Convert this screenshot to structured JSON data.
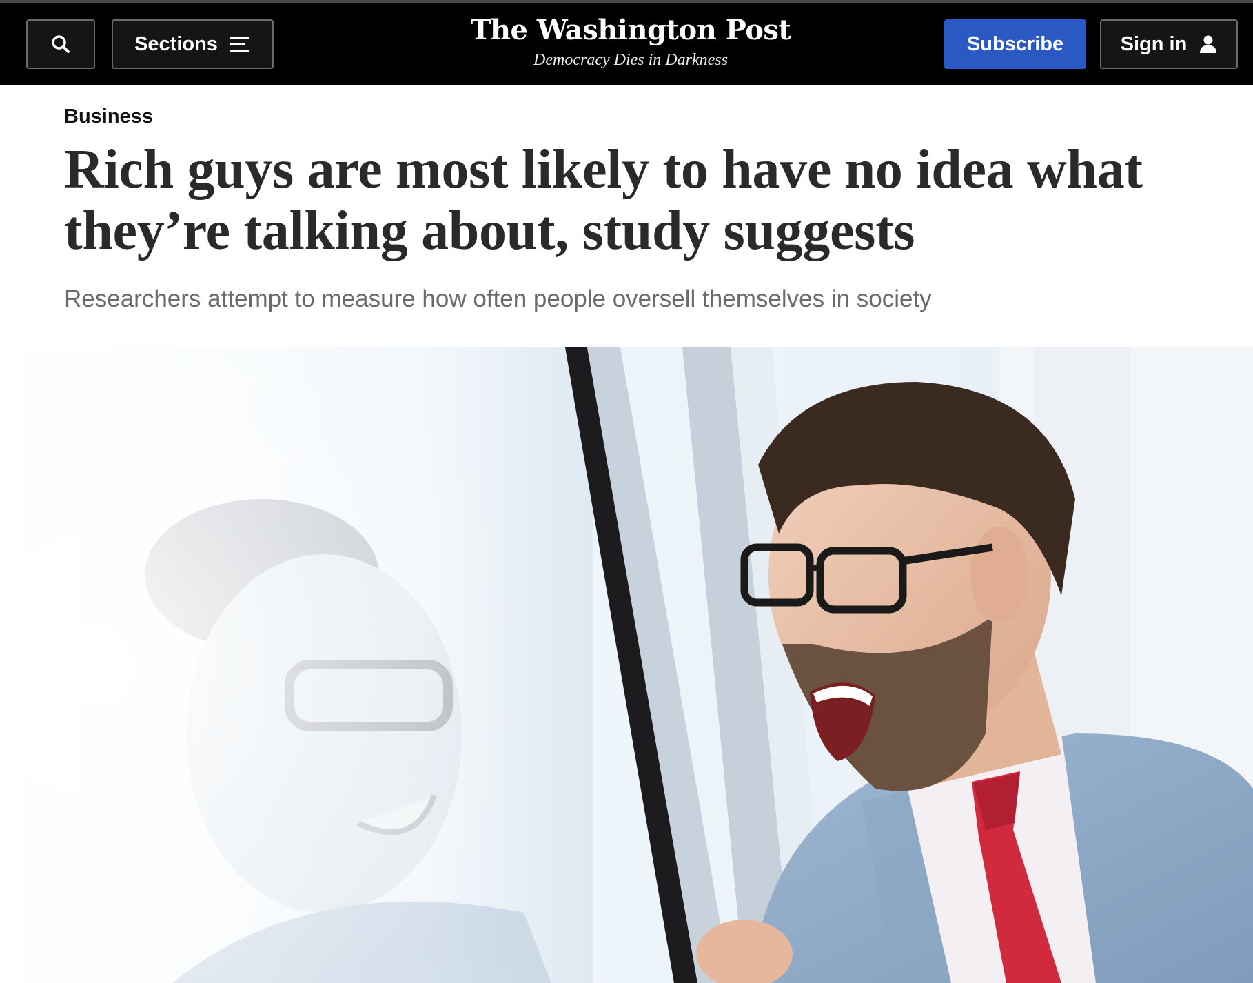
{
  "header": {
    "search_icon": "search-icon",
    "sections_label": "Sections",
    "sections_icon": "menu-icon",
    "wordmark": "The Washington Post",
    "tagline": "Democracy Dies in Darkness",
    "subscribe_label": "Subscribe",
    "signin_label": "Sign in",
    "signin_icon": "user-icon",
    "subscribe_color": "#2b59c3"
  },
  "article": {
    "kicker": "Business",
    "headline": "Rich guys are most likely to have no idea what they’re talking about, study suggests",
    "dek": "Researchers attempt to measure how often people oversell themselves in society"
  },
  "hero_image": {
    "icon": "laughing-man-at-window-photo"
  }
}
